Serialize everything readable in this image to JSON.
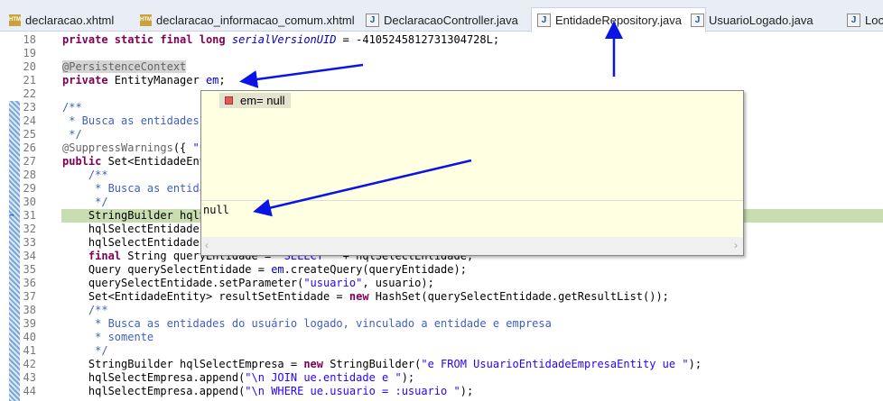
{
  "tabs": [
    {
      "label": "declaracao.xhtml",
      "icon": "html-file-icon"
    },
    {
      "label": "declaracao_informacao_comum.xhtml",
      "icon": "html-file-icon"
    },
    {
      "label": "DeclaracaoController.java",
      "icon": "java-file-icon"
    },
    {
      "label": "EntidadeRepository.java",
      "icon": "java-file-icon",
      "active": true
    },
    {
      "label": "UsuarioLogado.java",
      "icon": "java-file-icon"
    },
    {
      "label": "LocaleC",
      "icon": "java-file-icon"
    }
  ],
  "lines": [
    {
      "n": "18",
      "html": "<span class='k'>private static final long</span> <span class='i'>serialVersionUID</span> = -4105245812731304728L;"
    },
    {
      "n": "19",
      "html": ""
    },
    {
      "n": "20",
      "html": "<span class='a' style='background:#d4d4d4'>@PersistenceContext</span>"
    },
    {
      "n": "21",
      "html": "<span class='k'>private</span> EntityManager <span class='f'>em</span>;"
    },
    {
      "n": "22",
      "html": ""
    },
    {
      "n": "23",
      "html": "<span class='c'>/**</span>"
    },
    {
      "n": "24",
      "html": "<span class='c'> * Busca as entidades</span>"
    },
    {
      "n": "25",
      "html": "<span class='c'> */</span>"
    },
    {
      "n": "26",
      "html": "<span class='a'>@SuppressWarnings</span>({ <span class='s'>\"u</span>"
    },
    {
      "n": "27",
      "html": "<span class='k'>public</span> Set&lt;EntidadeEnt"
    },
    {
      "n": "28",
      "html": "    <span class='c'>/**</span>"
    },
    {
      "n": "29",
      "html": "<span class='c'>     * Busca as entida</span>"
    },
    {
      "n": "30",
      "html": "<span class='c'>     */</span>"
    },
    {
      "n": "31",
      "html": "    StringBuilder hqlS",
      "current": true
    },
    {
      "n": "32",
      "html": "    hqlSelectEntidade."
    },
    {
      "n": "33",
      "html": "    hqlSelectEntidade."
    },
    {
      "n": "34",
      "html": "    <span class='k'>final</span> String queryEntidade = <span class='s'>\"SELECT \"</span> + hqlSelectEntidade;"
    },
    {
      "n": "35",
      "html": "    Query querySelectEntidade = <span class='f'>em</span>.createQuery(queryEntidade);"
    },
    {
      "n": "36",
      "html": "    querySelectEntidade.setParameter(<span class='s'>\"usuario\"</span>, usuario);"
    },
    {
      "n": "37",
      "html": "    Set&lt;EntidadeEntity&gt; resultSetEntidade = <span class='k'>new</span> HashSet(querySelectEntidade.getResultList());"
    },
    {
      "n": "38",
      "html": "    <span class='c'>/**</span>"
    },
    {
      "n": "39",
      "html": "<span class='c'>     * Busca as entidades do usuário logado, vinculado a entidade e empresa</span>"
    },
    {
      "n": "40",
      "html": "<span class='c'>     * somente</span>"
    },
    {
      "n": "41",
      "html": "<span class='c'>     */</span>"
    },
    {
      "n": "42",
      "html": "    StringBuilder hqlSelectEmpresa = <span class='k'>new</span> StringBuilder(<span class='s'>\"e FROM UsuarioEntidadeEmpresaEntity ue \"</span>);"
    },
    {
      "n": "43",
      "html": "    hqlSelectEmpresa.append(<span class='s'>\"\\n JOIN ue.entidade e \"</span>);"
    },
    {
      "n": "44",
      "html": "    hqlSelectEmpresa.append(<span class='s'>\"\\n WHERE ue.usuario = :usuario \"</span>);"
    }
  ],
  "popup": {
    "variable": "em= null",
    "detail": "null"
  },
  "colors": {
    "arrow": "#0a14e6",
    "current_line": "#c8ddb0"
  }
}
